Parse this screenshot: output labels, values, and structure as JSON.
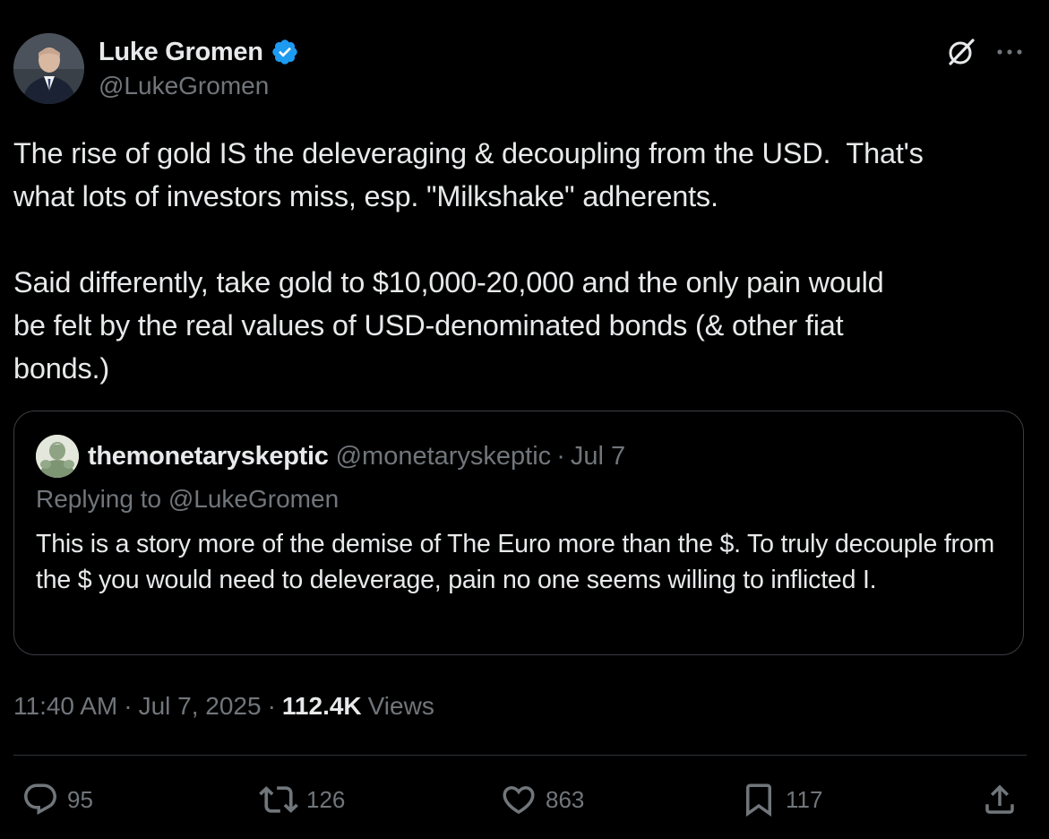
{
  "author": {
    "display_name": "Luke Gromen",
    "handle": "@LukeGromen",
    "verified_color": "#1d9bf0"
  },
  "header_icons": {
    "grok": "grok-icon",
    "more": "more-icon"
  },
  "tweet": {
    "text": "The rise of gold IS the deleveraging & decoupling from the USD.  That's\nwhat lots of investors miss, esp. \"Milkshake\" adherents.\n\nSaid differently, take gold to $10,000-20,000 and the only pain would\nbe felt by the real values of USD-denominated bonds (& other fiat\nbonds.)"
  },
  "quote": {
    "display_name": "themonetaryskeptic",
    "handle": "@monetaryskeptic",
    "separator": "·",
    "date": "Jul 7",
    "replying_to": "Replying to @LukeGromen",
    "text": "This is a story more of the demise of The Euro more than the $. To truly decouple from the $ you would need to deleverage, pain no one seems willing to inflicted I."
  },
  "meta": {
    "time": "11:40 AM",
    "separator": "·",
    "date": "Jul 7, 2025",
    "views_count": "112.4K",
    "views_label": "Views"
  },
  "actions": {
    "replies": "95",
    "reposts": "126",
    "likes": "863",
    "bookmarks": "117"
  },
  "colors": {
    "background": "#000000",
    "primary_text": "#e7e9ea",
    "secondary_text": "#71767b",
    "border": "#2f3336",
    "accent": "#1d9bf0"
  }
}
